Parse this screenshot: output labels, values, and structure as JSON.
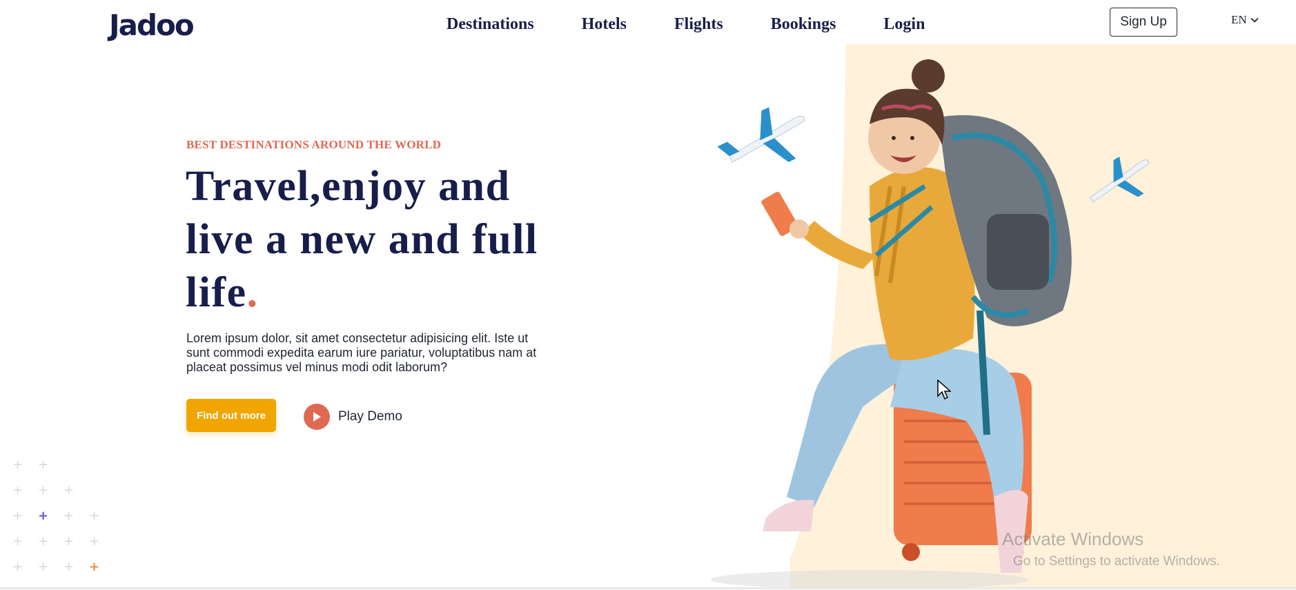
{
  "header": {
    "logo": "Jadoo",
    "nav": [
      {
        "label": "Destinations"
      },
      {
        "label": "Hotels"
      },
      {
        "label": "Flights"
      },
      {
        "label": "Bookings"
      },
      {
        "label": "Login"
      }
    ],
    "signup_label": "Sign Up",
    "language": "EN"
  },
  "hero": {
    "tagline": "BEST DESTINATIONS AROUND THE WORLD",
    "headline": "Travel,enjoy and live a new and full life",
    "headline_dot": ".",
    "description": "Lorem ipsum dolor, sit amet consectetur adipisicing elit. Iste ut sunt commodi expedita earum iure pariatur, voluptatibus nam at placeat possimus vel minus modi odit laborum?",
    "cta_label": "Find out more",
    "play_label": "Play Demo"
  },
  "watermark": {
    "line1": "Activate Windows",
    "line2": "Go to Settings to activate Windows."
  },
  "colors": {
    "primary_text": "#181E4B",
    "accent_red": "#DF6951",
    "accent_yellow": "#F1A501",
    "blob": "#FFF1DA",
    "plus_purple": "#6C4BD8",
    "plus_orange": "#F18A3B"
  },
  "icons": {
    "play": "play-icon",
    "chevron": "chevron-down-icon",
    "plane": "airplane-icon",
    "cursor": "mouse-cursor-icon"
  }
}
